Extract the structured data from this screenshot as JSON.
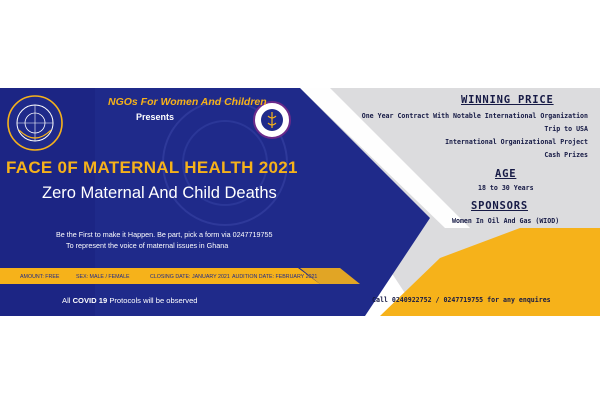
{
  "organizer": "NGOs For Women And Children",
  "presents": "Presents",
  "title": "FACE 0F MATERNAL HEALTH 2021",
  "subtitle": "Zero Maternal And Child Deaths",
  "body_lines": [
    "Be the First to make it Happen. Be part, pick a form via 0247719755",
    "To represent the voice of maternal issues in Ghana"
  ],
  "info_bar": {
    "amount": "AMOUNT: FREE",
    "sex": "SEX: MALE / FEMALE",
    "closing": "CLOSING DATE: JANUARY 2021",
    "audition": "AUDITION DATE: FEBRUARY 2021"
  },
  "covid_prefix": "All",
  "covid_bold": "COVID 19",
  "covid_suffix": "Protocols will be observed",
  "winning_price": {
    "heading": "WINNING PRICE",
    "items": [
      "One Year Contract With Notable International Organization",
      "Trip to USA",
      "International Organizational Project",
      "Cash Prizes"
    ]
  },
  "age": {
    "heading": "AGE",
    "value": "18 to 30 Years"
  },
  "sponsors": {
    "heading": "SPONSORS",
    "value": "Women In Oil And Gas (WIOD)"
  },
  "contact": "Call 0240922752 / 0247719755 for any enquires",
  "colors": {
    "navy": "#1f2a8a",
    "navy_dark": "#161a45",
    "yellow": "#f6b21a",
    "grey": "#d9dadc",
    "white": "#ffffff"
  }
}
